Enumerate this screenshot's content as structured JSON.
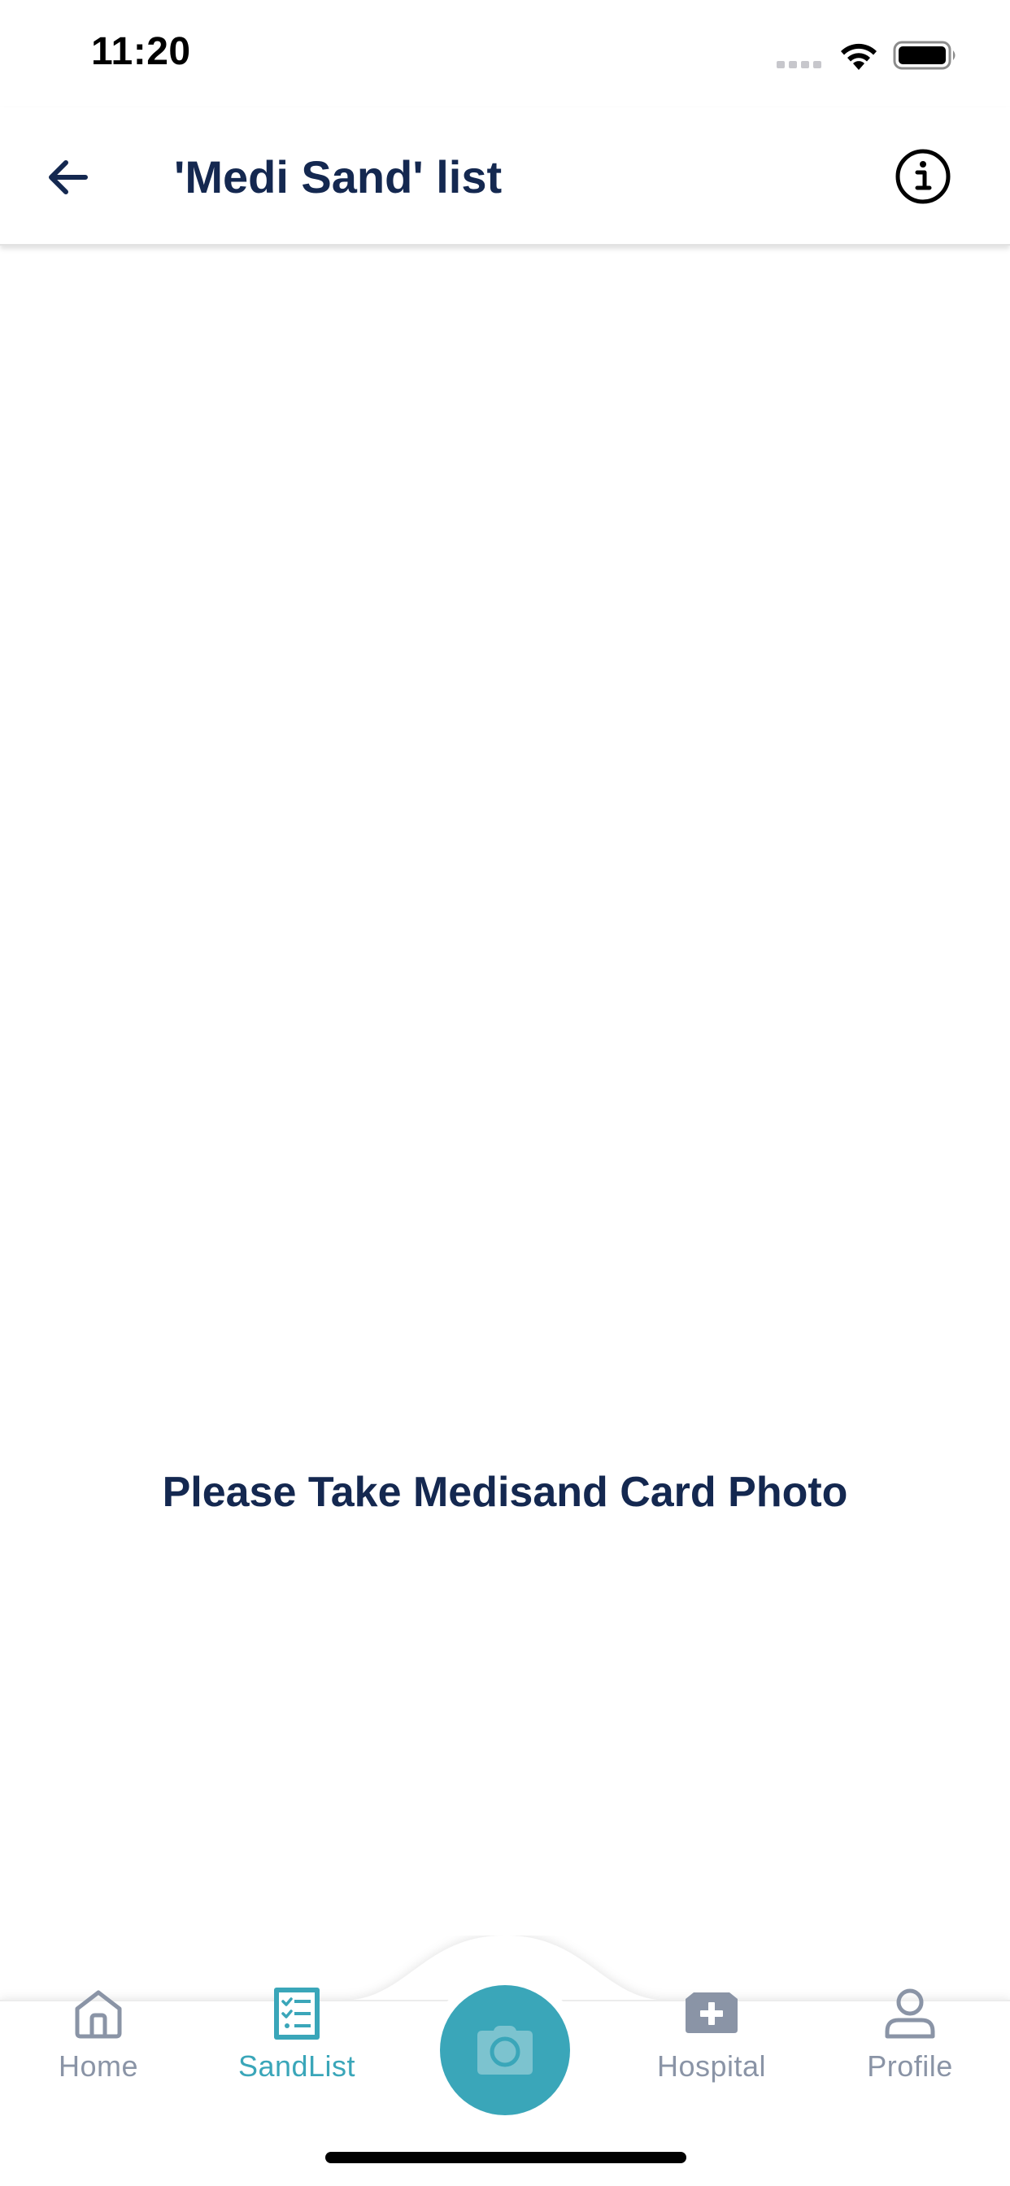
{
  "status_bar": {
    "time": "11:20"
  },
  "header": {
    "title": "'Medi Sand' list",
    "back_icon": "arrow-left-icon",
    "info_icon": "info-circle-icon"
  },
  "main": {
    "empty_message": "Please Take Medisand Card Photo"
  },
  "bottom_nav": {
    "items": [
      {
        "label": "Home",
        "icon": "home-icon",
        "active": false
      },
      {
        "label": "SandList",
        "icon": "checklist-icon",
        "active": true
      },
      {
        "label": "Hospital",
        "icon": "hospital-icon",
        "active": false
      },
      {
        "label": "Profile",
        "icon": "profile-icon",
        "active": false
      }
    ],
    "camera_icon": "camera-icon"
  },
  "colors": {
    "primary_text": "#142850",
    "accent": "#3aa6b9",
    "inactive": "#8a94a6",
    "background": "#ffffff"
  }
}
